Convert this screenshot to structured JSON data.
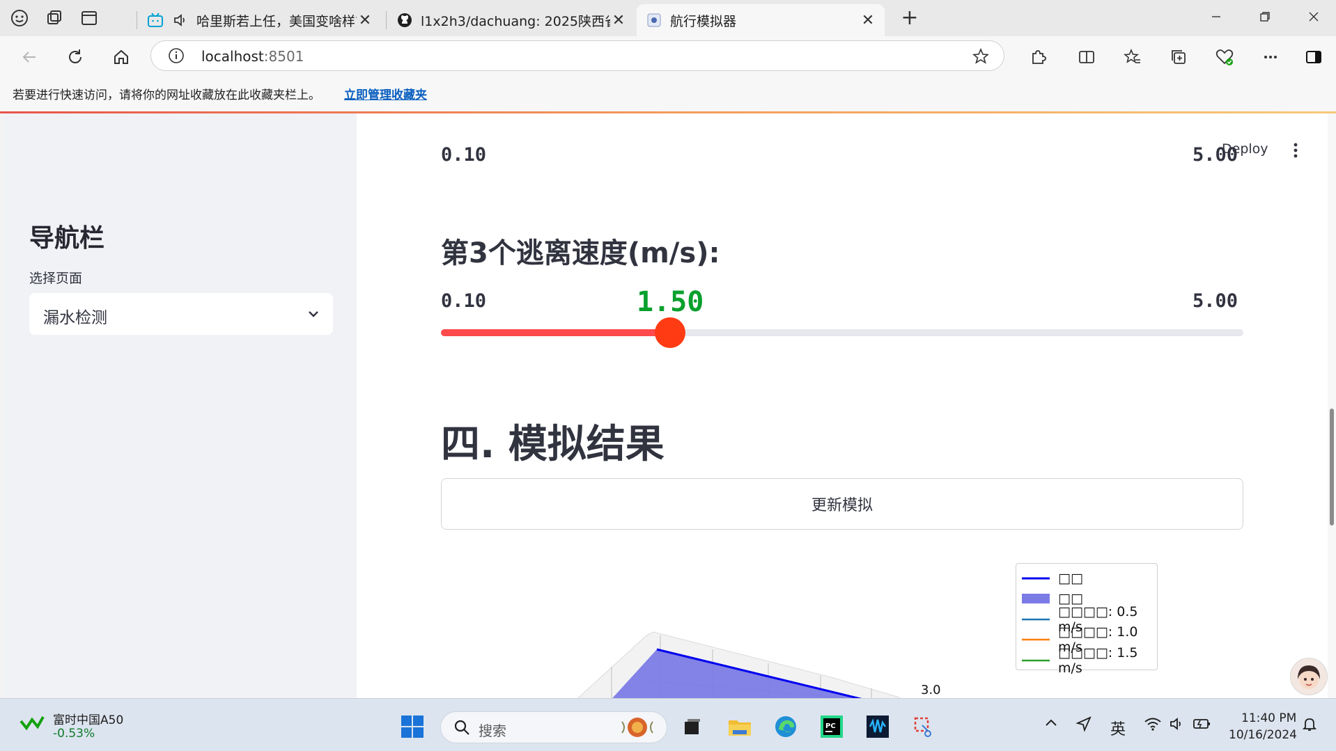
{
  "browser": {
    "tabs": [
      {
        "title": "哈里斯若上任，美国变啥样?",
        "close": "✕"
      },
      {
        "title": "l1x2h3/dachuang: 2025陕西省大创",
        "close": "✕"
      },
      {
        "title": "航行模拟器",
        "close": "✕"
      }
    ],
    "new_tab": "+",
    "url_host": "localhost",
    "url_port": ":8501",
    "favorites_hint": "若要进行快速访问，请将你的网址收藏放在此收藏夹栏上。",
    "favorites_link": "立即管理收藏夹"
  },
  "sidebar": {
    "title": "导航栏",
    "select_label": "选择页面",
    "select_value": "漏水检测"
  },
  "main": {
    "deploy": "Deploy",
    "prev_slider_min": "0.10",
    "prev_slider_max": "5.00",
    "slider": {
      "label": "第3个逃离速度(m/s):",
      "value_text": "1.50",
      "value": 1.5,
      "min": 0.1,
      "max": 5.0,
      "min_text": "0.10",
      "max_text": "5.00"
    },
    "section_title": "四. 模拟结果",
    "update_button": "更新模拟",
    "plot": {
      "tick_label": "3.0",
      "legend": [
        {
          "label": "□□",
          "color": "#0000ee",
          "kind": "line"
        },
        {
          "label": "□□",
          "color": "#7b7be6",
          "kind": "patch"
        },
        {
          "label": "□□□□: 0.5 m/s",
          "color": "#1f77b4",
          "kind": "line"
        },
        {
          "label": "□□□□: 1.0 m/s",
          "color": "#ff7f0e",
          "kind": "line"
        },
        {
          "label": "□□□□: 1.5 m/s",
          "color": "#2ca02c",
          "kind": "line"
        }
      ]
    }
  },
  "taskbar": {
    "stock_name": "富时中国A50",
    "stock_change": "-0.53%",
    "search_placeholder": "搜索",
    "ime": "英",
    "time": "11:40 PM",
    "date": "10/16/2024"
  },
  "colors": {
    "accent": "#ff4b4b",
    "slider_value": "#09a02d",
    "link": "#0a5fbf"
  }
}
